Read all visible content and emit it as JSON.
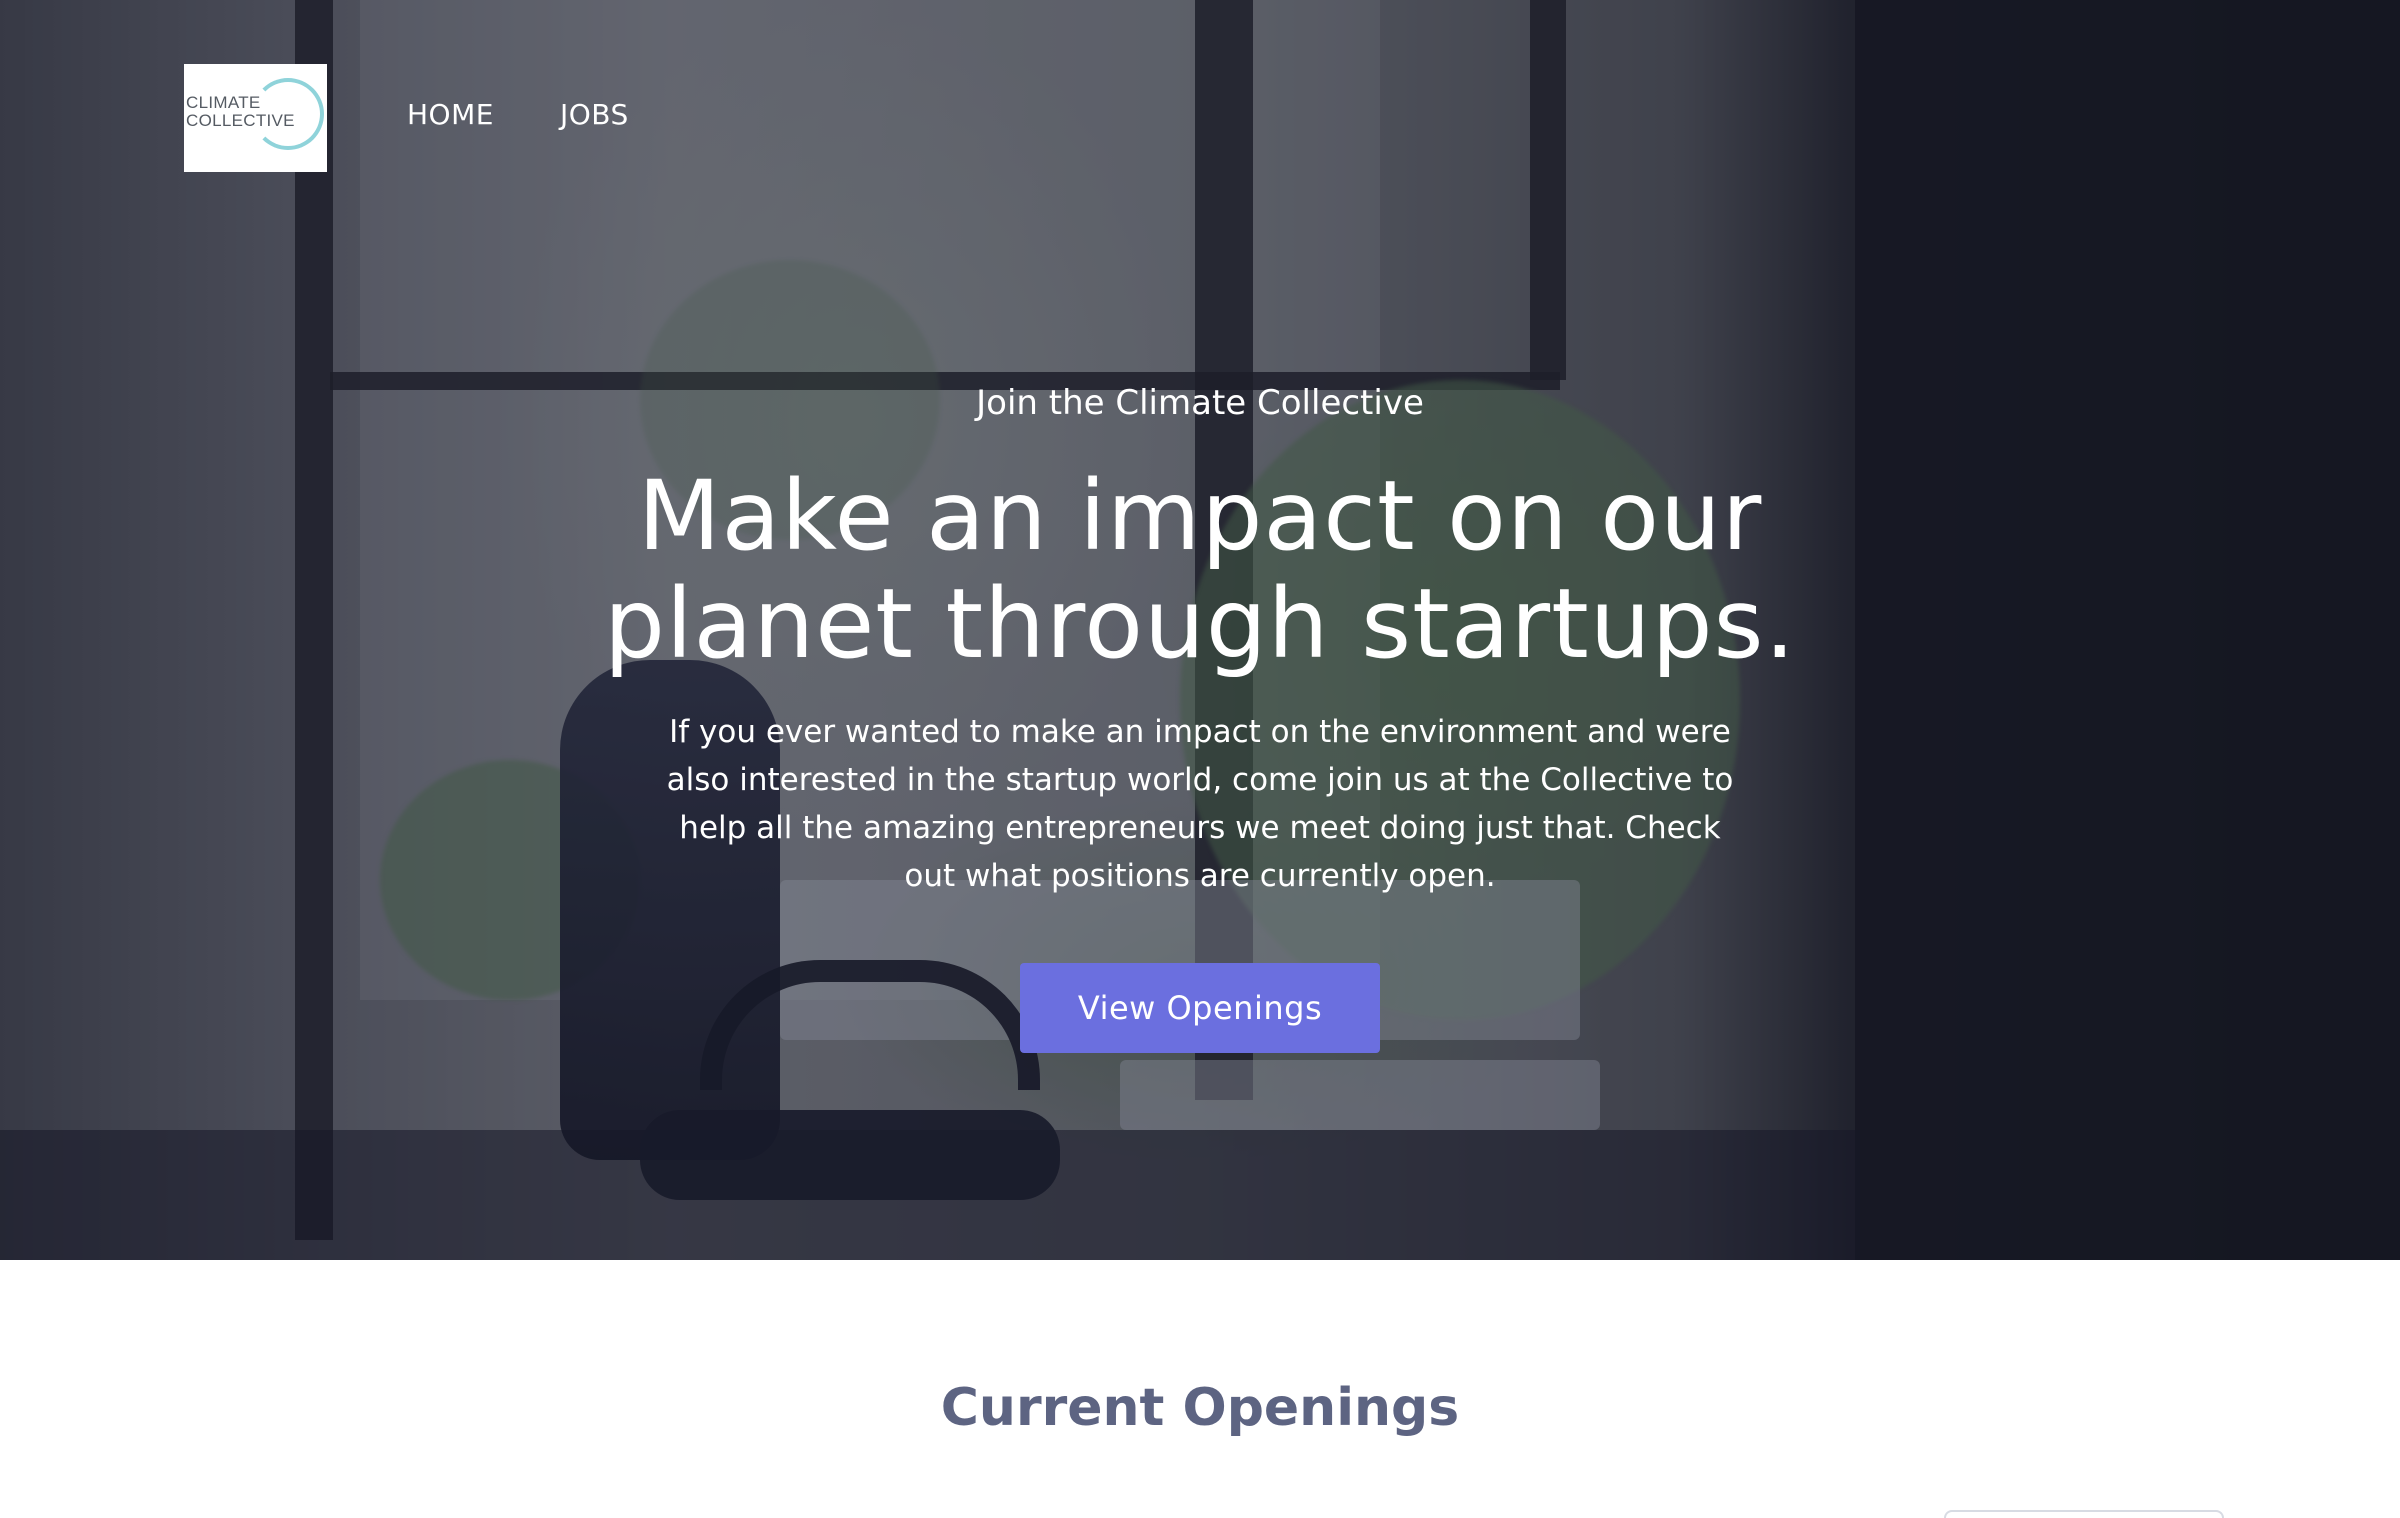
{
  "nav": {
    "logo_text_line1": "CLIMATE",
    "logo_text_line2": "COLLECTIVE",
    "links": [
      "HOME",
      "JOBS"
    ]
  },
  "hero": {
    "eyebrow": "Join the Climate Collective",
    "headline_line1": "Make an impact on our",
    "headline_line2": "planet through startups.",
    "body": "If you ever wanted to make an impact on the environment and were also interested in the startup world, come join us at the Collective to help all the amazing entrepreneurs we meet doing just that. Check out what positions are currently open.",
    "cta_label": "View Openings"
  },
  "openings": {
    "title": "Current Openings"
  },
  "colors": {
    "accent": "#6b6fdf",
    "section_title": "#5d6482",
    "logo_ring": "#8fd3da"
  }
}
